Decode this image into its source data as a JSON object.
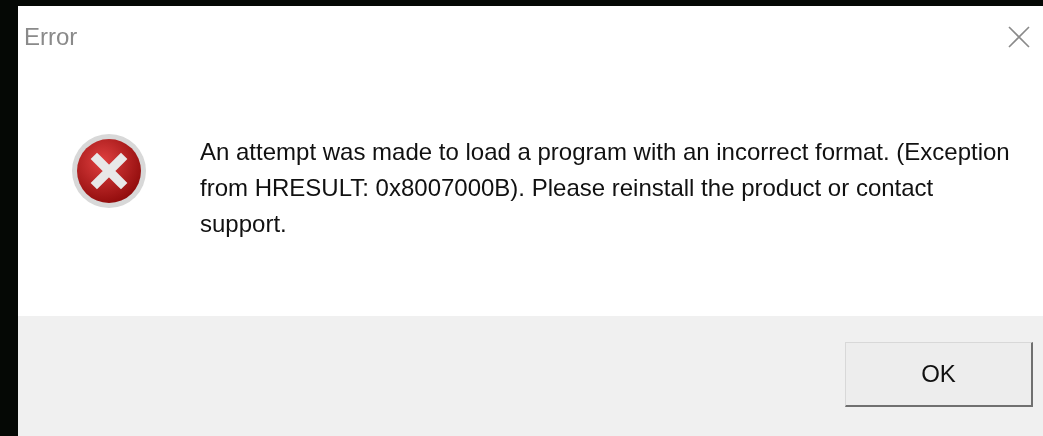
{
  "window": {
    "title": "Error"
  },
  "message": "An attempt was made to load a program with an incorrect format. (Exception from HRESULT: 0x8007000B). Please reinstall the product or contact support.",
  "buttons": [
    "OK"
  ]
}
